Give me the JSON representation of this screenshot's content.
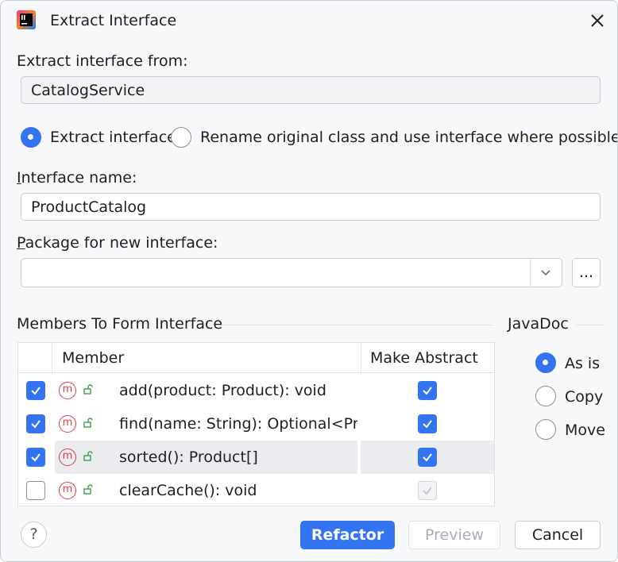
{
  "window": {
    "title": "Extract Interface"
  },
  "extract_from": {
    "label": "Extract interface from:",
    "value": "CatalogService"
  },
  "mode": {
    "option_extract": "Extract interface",
    "option_rename": "Rename original class and use interface where possible",
    "selected": "extract"
  },
  "interface_name": {
    "label": "Interface name:",
    "value": "ProductCatalog"
  },
  "package": {
    "label": "Package for new interface:",
    "value": "",
    "browse_label": "..."
  },
  "members": {
    "section_label": "Members To Form Interface",
    "columns": {
      "member": "Member",
      "make_abstract": "Make Abstract"
    },
    "rows": [
      {
        "checked": true,
        "member": "add(product: Product): void",
        "make_abstract": true,
        "abstract_enabled": true,
        "selected": false
      },
      {
        "checked": true,
        "member": "find(name: String): Optional<Proc",
        "make_abstract": true,
        "abstract_enabled": true,
        "selected": false
      },
      {
        "checked": true,
        "member": "sorted(): Product[]",
        "make_abstract": true,
        "abstract_enabled": true,
        "selected": true
      },
      {
        "checked": false,
        "member": "clearCache(): void",
        "make_abstract": true,
        "abstract_enabled": false,
        "selected": false
      }
    ],
    "member_icon_letter": "m"
  },
  "javadoc": {
    "section_label": "JavaDoc",
    "options": [
      "As is",
      "Copy",
      "Move"
    ],
    "selected": "As is"
  },
  "buttons": {
    "help": "?",
    "refactor": "Refactor",
    "preview": "Preview",
    "cancel": "Cancel"
  },
  "colors": {
    "accent": "#3574f0",
    "method_icon": "#db3b4b",
    "lock_icon": "#3c9b4b"
  }
}
